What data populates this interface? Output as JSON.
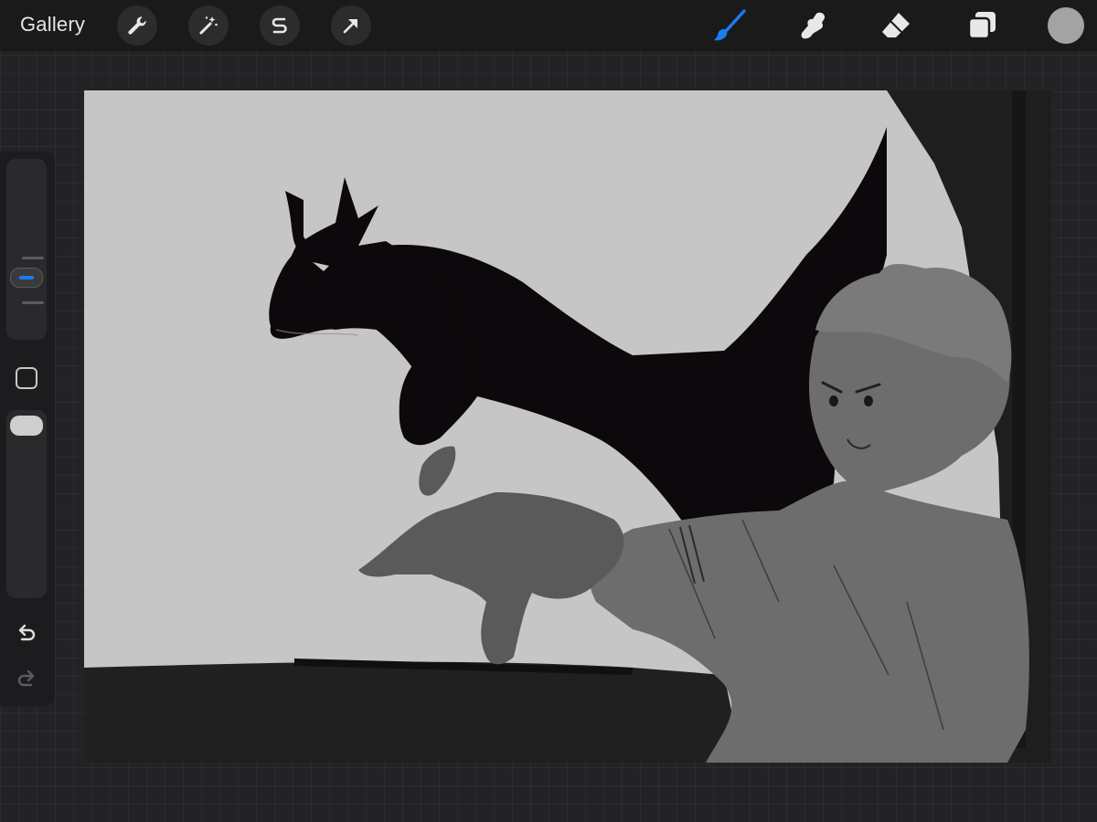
{
  "toolbar": {
    "gallery_label": "Gallery",
    "left_tools": [
      {
        "icon": "wrench-icon",
        "name": "actions"
      },
      {
        "icon": "magic-wand-icon",
        "name": "adjustments"
      },
      {
        "icon": "selection-s-icon",
        "name": "selection"
      },
      {
        "icon": "arrow-cursor-icon",
        "name": "transform"
      }
    ],
    "right_tools": [
      {
        "icon": "brush-icon",
        "name": "paint",
        "active": true
      },
      {
        "icon": "smudge-finger-icon",
        "name": "smudge"
      },
      {
        "icon": "eraser-icon",
        "name": "erase"
      },
      {
        "icon": "layers-icon",
        "name": "layers"
      }
    ],
    "current_color": "#a3a3a3"
  },
  "sidebar": {
    "brush_size_level": 0.17,
    "opacity_level": 0.0,
    "active_accent": "#1a7cf0"
  },
  "colors": {
    "canvas_background": "#c6c6c6",
    "shadow": "#0c080b",
    "figure": "#6d6d6d",
    "foreground_dark": "#202020"
  }
}
